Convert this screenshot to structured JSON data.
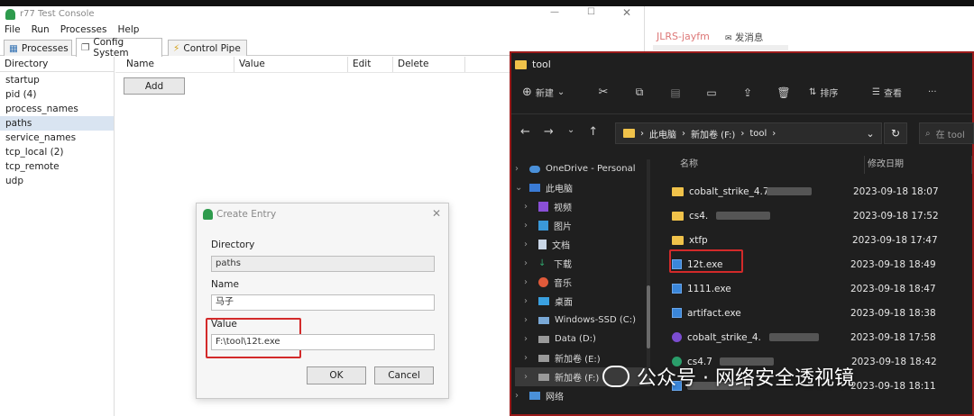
{
  "app": {
    "title": "r77 Test Console",
    "menu": [
      "File",
      "Run",
      "Processes",
      "Help"
    ],
    "tabs": [
      "Processes",
      "Config System",
      "Control Pipe"
    ],
    "directory": {
      "header": "Directory",
      "items": [
        "startup",
        "pid (4)",
        "process_names",
        "paths",
        "service_names",
        "tcp_local (2)",
        "tcp_remote",
        "udp"
      ]
    },
    "columns": [
      "Name",
      "Value",
      "Edit",
      "Delete"
    ],
    "add": "Add"
  },
  "dialog": {
    "title": "Create Entry",
    "dir_label": "Directory",
    "dir_value": "paths",
    "name_label": "Name",
    "name_value": "马子",
    "value_label": "Value",
    "value_value": "F:\\tool\\12t.exe",
    "ok": "OK",
    "cancel": "Cancel"
  },
  "bg": {
    "user": "JLRS-jayfm",
    "msg": "发消息"
  },
  "explorer": {
    "title": "tool",
    "new": "新建",
    "sort": "排序",
    "view": "查看",
    "more": "···",
    "breadcrumb": [
      "此电脑",
      "新加卷 (F:)",
      "tool"
    ],
    "search": "在 tool",
    "cols": {
      "name": "名称",
      "date": "修改日期"
    },
    "nav": [
      "OneDrive - Personal",
      "此电脑",
      "视频",
      "图片",
      "文档",
      "下载",
      "音乐",
      "桌面",
      "Windows-SSD (C:)",
      "Data (D:)",
      "新加卷 (E:)",
      "新加卷 (F:)",
      "网络"
    ],
    "files": [
      {
        "name": "cobalt_strike_4.7v",
        "date": "2023-09-18 18:07",
        "type": "folder"
      },
      {
        "name": "cs4.",
        "date": "2023-09-18 17:52",
        "type": "folder"
      },
      {
        "name": "xtfp",
        "date": "2023-09-18 17:47",
        "type": "folder"
      },
      {
        "name": "12t.exe",
        "date": "2023-09-18 18:49",
        "type": "exe"
      },
      {
        "name": "1111.exe",
        "date": "2023-09-18 18:47",
        "type": "exe"
      },
      {
        "name": "artifact.exe",
        "date": "2023-09-18 18:38",
        "type": "exe"
      },
      {
        "name": "cobalt_strike_4.",
        "date": "2023-09-18 17:58",
        "type": "cs"
      },
      {
        "name": "cs4.7",
        "date": "2023-09-18 18:42",
        "type": "cs2"
      },
      {
        "name": "",
        "date": "2023-09-18 18:11",
        "type": "exe"
      }
    ]
  },
  "watermark": "公众号 · 网络安全透视镜"
}
